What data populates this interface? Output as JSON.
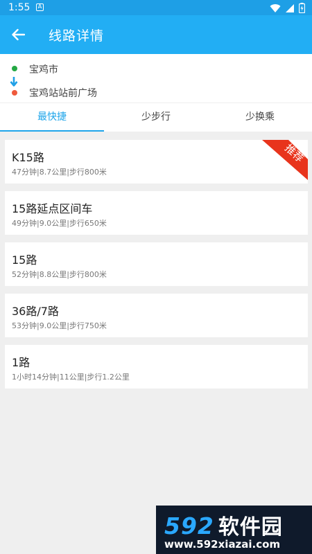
{
  "status_bar": {
    "time": "1:55",
    "notif_glyph": "A"
  },
  "app_bar": {
    "title": "线路详情"
  },
  "route": {
    "origin": "宝鸡市",
    "destination": "宝鸡站站前广场"
  },
  "tabs": [
    {
      "label": "最快捷",
      "active": true
    },
    {
      "label": "少步行",
      "active": false
    },
    {
      "label": "少换乘",
      "active": false
    }
  ],
  "routes": [
    {
      "name": "K15路",
      "meta": "47分钟|8.7公里|步行800米",
      "badge": "推荐"
    },
    {
      "name": "15路延点区间车",
      "meta": "49分钟|9.0公里|步行650米"
    },
    {
      "name": "15路",
      "meta": "52分钟|8.8公里|步行800米"
    },
    {
      "name": "36路/7路",
      "meta": "53分钟|9.0公里|步行750米"
    },
    {
      "name": "1路",
      "meta": "1小时14分钟|11公里|步行1.2公里"
    }
  ],
  "watermark": {
    "brand_num": "592",
    "brand_cn": "软件园",
    "url": "www.592xiazai.com"
  },
  "colors": {
    "primary": "#22aef4",
    "accent": "#1ea5ea",
    "badge": "#e8341c",
    "origin_dot": "#24a844",
    "dest_dot": "#ef5a3c"
  }
}
